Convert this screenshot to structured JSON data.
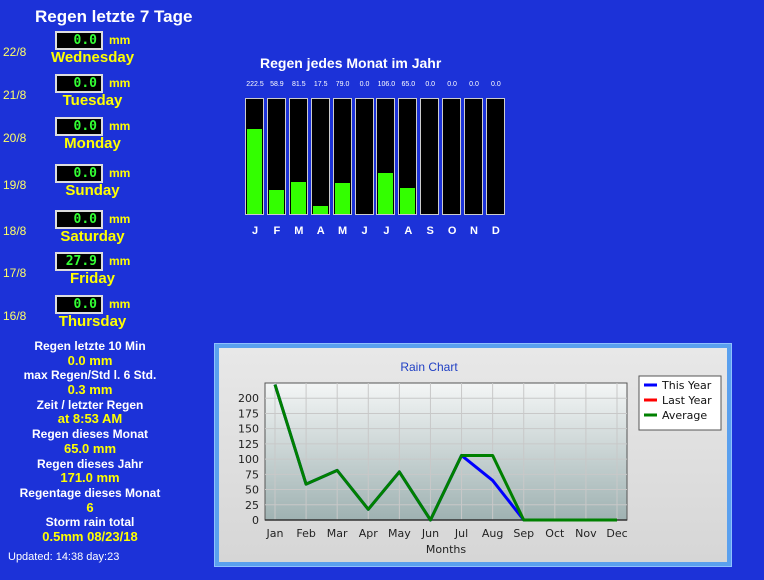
{
  "page_title": "Regen letzte 7 Tage",
  "unit": "mm",
  "days": [
    {
      "date": "22/8",
      "value": "0.0",
      "name": "Wednesday"
    },
    {
      "date": "21/8",
      "value": "0.0",
      "name": "Tuesday"
    },
    {
      "date": "20/8",
      "value": "0.0",
      "name": "Monday"
    },
    {
      "date": "19/8",
      "value": "0.0",
      "name": "Sunday"
    },
    {
      "date": "18/8",
      "value": "0.0",
      "name": "Saturday"
    },
    {
      "date": "17/8",
      "value": "27.9",
      "name": "Friday"
    },
    {
      "date": "16/8",
      "value": "0.0",
      "name": "Thursday"
    }
  ],
  "stats": [
    {
      "label": "Regen letzte 10 Min",
      "value": "0.0 mm"
    },
    {
      "label": "max Regen/Std l. 6 Std.",
      "value": "0.3 mm"
    },
    {
      "label": "Zeit / letzter Regen",
      "value": "at 8:53 AM"
    },
    {
      "label": "Regen dieses Monat",
      "value": "65.0 mm"
    },
    {
      "label": "Regen dieses Jahr",
      "value": "171.0 mm"
    },
    {
      "label": "Regentage dieses Monat",
      "value": "6"
    },
    {
      "label": "Storm rain total",
      "value": "0.5mm 08/23/18"
    }
  ],
  "updated": "Updated: 14:38 day:23",
  "monthly": {
    "title": "Regen jedes Monat im Jahr",
    "letters": [
      "J",
      "F",
      "M",
      "A",
      "M",
      "J",
      "J",
      "A",
      "S",
      "O",
      "N",
      "D"
    ],
    "value_labels": [
      "222.5",
      "58.9",
      "81.5",
      "17.5",
      "79.0",
      "0.0",
      "106.0",
      "65.0",
      "0.0",
      "0.0",
      "0.0",
      "0.0"
    ],
    "fill_fraction": [
      0.74,
      0.21,
      0.28,
      0.07,
      0.27,
      0.0,
      0.36,
      0.23,
      0,
      0,
      0,
      0
    ]
  },
  "chart_data": {
    "type": "line",
    "title": "Rain Chart",
    "xlabel": "Months",
    "ylabel": "",
    "categories": [
      "Jan",
      "Feb",
      "Mar",
      "Apr",
      "May",
      "Jun",
      "Jul",
      "Aug",
      "Sep",
      "Oct",
      "Nov",
      "Dec"
    ],
    "yticks": [
      0,
      25,
      50,
      75,
      100,
      125,
      150,
      175,
      200
    ],
    "ylim": [
      0,
      225
    ],
    "grid": true,
    "legend_position": "top-right",
    "series": [
      {
        "name": "This Year",
        "color": "#0000ff",
        "values": [
          222.5,
          58.9,
          81.5,
          17.5,
          79.0,
          0.0,
          106.0,
          65.0,
          0,
          0,
          0,
          0
        ]
      },
      {
        "name": "Last Year",
        "color": "#ff0000",
        "values": []
      },
      {
        "name": "Average",
        "color": "#008000",
        "values": [
          222.5,
          58.9,
          81.5,
          17.5,
          79.0,
          0.0,
          106.0,
          106.0,
          0,
          0,
          0,
          0
        ]
      }
    ]
  }
}
